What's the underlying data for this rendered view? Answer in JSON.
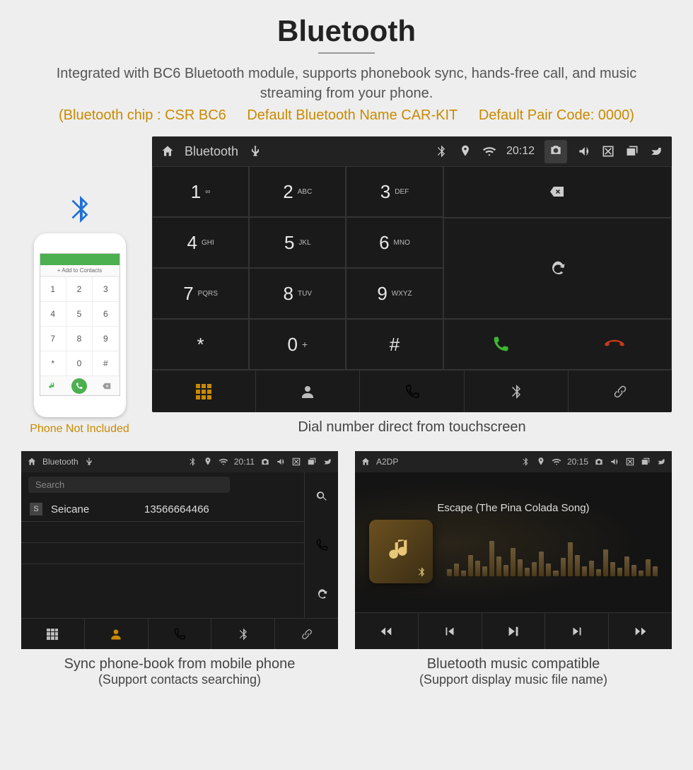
{
  "header": {
    "title": "Bluetooth",
    "subtitle": "Integrated with BC6 Bluetooth module, supports phonebook sync, hands-free call, and music streaming from your phone.",
    "info_chip": "(Bluetooth chip : CSR BC6",
    "info_name": "Default Bluetooth Name CAR-KIT",
    "info_code": "Default Pair Code: 0000)"
  },
  "phone": {
    "add_to_contacts": "+  Add to Contacts",
    "note": "Phone Not Included",
    "pad": [
      "1",
      "2",
      "3",
      "4",
      "5",
      "6",
      "7",
      "8",
      "9",
      "*",
      "0",
      "#"
    ]
  },
  "dialer": {
    "app_name": "Bluetooth",
    "time": "20:12",
    "keys": [
      {
        "num": "1",
        "letters": "∞"
      },
      {
        "num": "2",
        "letters": "ABC"
      },
      {
        "num": "3",
        "letters": "DEF"
      },
      {
        "num": "4",
        "letters": "GHI"
      },
      {
        "num": "5",
        "letters": "JKL"
      },
      {
        "num": "6",
        "letters": "MNO"
      },
      {
        "num": "7",
        "letters": "PQRS"
      },
      {
        "num": "8",
        "letters": "TUV"
      },
      {
        "num": "9",
        "letters": "WXYZ"
      },
      {
        "num": "*",
        "letters": ""
      },
      {
        "num": "0",
        "letters": "+"
      },
      {
        "num": "#",
        "letters": ""
      }
    ],
    "caption": "Dial number direct from touchscreen"
  },
  "contacts": {
    "app_name": "Bluetooth",
    "time": "20:11",
    "search_placeholder": "Search",
    "row": {
      "letter": "S",
      "name": "Seicane",
      "number": "13566664466"
    },
    "caption_line1": "Sync phone-book from mobile phone",
    "caption_line2": "(Support contacts searching)"
  },
  "music": {
    "app_name": "A2DP",
    "time": "20:15",
    "track": "Escape (The Pina Colada Song)",
    "caption_line1": "Bluetooth music compatible",
    "caption_line2": "(Support display music file name)",
    "viz_heights": [
      10,
      18,
      8,
      30,
      22,
      14,
      50,
      28,
      16,
      40,
      24,
      12,
      20,
      35,
      18,
      8,
      26,
      48,
      30,
      14,
      22,
      10,
      38,
      20,
      12,
      28,
      16,
      8,
      24,
      14
    ]
  }
}
